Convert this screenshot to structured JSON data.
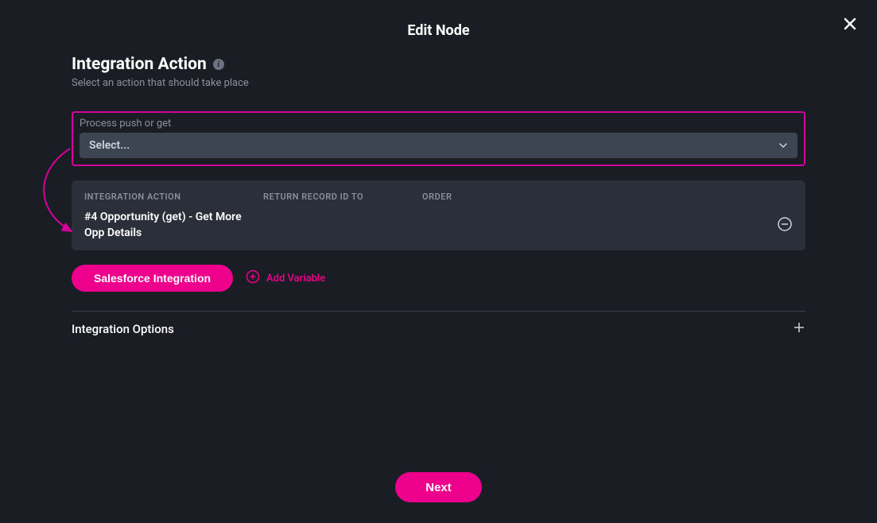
{
  "modal": {
    "title": "Edit Node"
  },
  "section": {
    "heading": "Integration Action",
    "subheading": "Select an action that should take place"
  },
  "field": {
    "label": "Process push or get",
    "select_value": "Select..."
  },
  "table": {
    "headers": {
      "action": "INTEGRATION ACTION",
      "return": "RETURN RECORD ID TO",
      "order": "ORDER"
    },
    "rows": [
      {
        "action": "#4 Opportunity (get) - Get More Opp Details"
      }
    ]
  },
  "buttons": {
    "primary": "Salesforce Integration",
    "add_variable": "Add Variable",
    "next": "Next"
  },
  "options": {
    "label": "Integration Options"
  }
}
